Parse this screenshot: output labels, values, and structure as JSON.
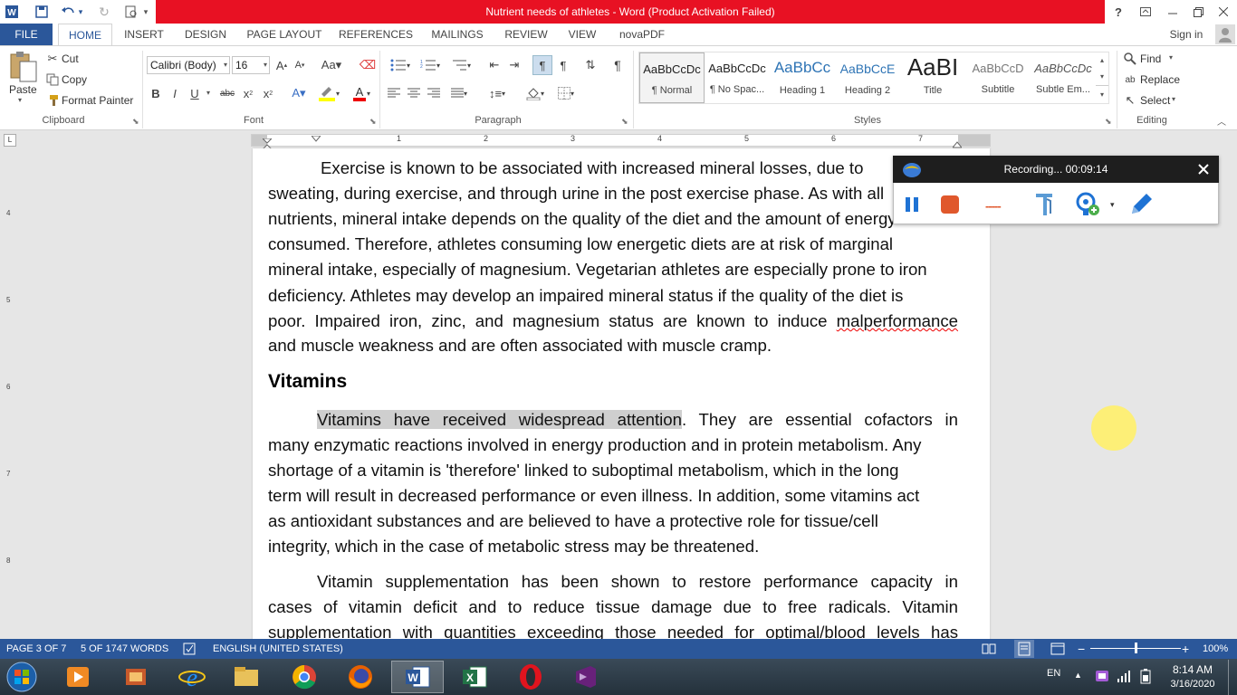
{
  "window": {
    "title": "Nutrient needs of athletes -  Word (Product Activation Failed)"
  },
  "qat": {
    "word_icon": "word-logo-icon",
    "save_icon": "save-icon",
    "undo_icon": "undo-icon",
    "redo_icon": "redo-icon",
    "preview_icon": "print-preview-icon"
  },
  "window_controls": {
    "help": "?",
    "ribbon_display": "ribbon-display-icon",
    "minimize": "minimize-icon",
    "restore": "restore-icon",
    "close": "close-icon"
  },
  "tabs": [
    "FILE",
    "HOME",
    "INSERT",
    "DESIGN",
    "PAGE LAYOUT",
    "REFERENCES",
    "MAILINGS",
    "REVIEW",
    "VIEW",
    "novaPDF"
  ],
  "sign_in": "Sign in",
  "clipboard": {
    "paste": "Paste",
    "cut": "Cut",
    "copy": "Copy",
    "format_painter": "Format Painter",
    "label": "Clipboard"
  },
  "font": {
    "name": "Calibri (Body)",
    "size": "16",
    "label": "Font"
  },
  "paragraph": {
    "label": "Paragraph"
  },
  "styles": {
    "label": "Styles",
    "items": [
      {
        "sample": "AaBbCcDc",
        "name": "¶ Normal"
      },
      {
        "sample": "AaBbCcDc",
        "name": "¶ No Spac..."
      },
      {
        "sample": "AaBbCc",
        "name": "Heading 1"
      },
      {
        "sample": "AaBbCcE",
        "name": "Heading 2"
      },
      {
        "sample": "AaBI",
        "name": "Title"
      },
      {
        "sample": "AaBbCcD",
        "name": "Subtitle"
      },
      {
        "sample": "AaBbCcDc",
        "name": "Subtle Em..."
      }
    ]
  },
  "editing": {
    "find": "Find",
    "replace": "Replace",
    "select": "Select",
    "label": "Editing"
  },
  "ruler": {
    "marks": [
      "1",
      "2",
      "3",
      "4",
      "5",
      "6",
      "7"
    ],
    "vmarks": [
      "4",
      "5",
      "6",
      "7",
      "8"
    ]
  },
  "document": {
    "para1_lines": [
      "Exercise is known to be associated with increased mineral losses, due to",
      "sweating, during exercise, and through urine in the post exercise phase. As with all",
      "nutrients, mineral intake depends on the quality of the diet and the amount of energy",
      "consumed. Therefore, athletes consuming low energetic diets are at risk of marginal",
      "mineral intake, especially of magnesium. Vegetarian athletes are especially prone to iron",
      "deficiency. Athletes may develop an impaired mineral status if the quality of the diet is",
      "poor. Impaired iron, zinc, and magnesium status are known to induce ",
      "and muscle weakness and are often associated with muscle cramp."
    ],
    "misspelled": "malperformance",
    "heading": "Vitamins",
    "highlight": "Vitamins have received widespread attention",
    "para2_first_rest": ". They are essential cofactors in",
    "para2_lines": [
      "many enzymatic reactions involved in energy production and in protein metabolism. Any",
      "shortage of a vitamin is 'therefore' linked to suboptimal metabolism, which in the long",
      "term will result in decreased performance or even illness. In addition, some vitamins act",
      "as antioxidant substances and are believed to have a protective role for tissue/cell",
      "integrity, which in the case of metabolic stress may be threatened."
    ],
    "para3_lines": [
      "Vitamin supplementation has been shown to restore performance capacity in",
      "cases of vitamin deficit and to reduce tissue damage due to free radicals. Vitamin",
      "supplementation with quantities exceeding those needed for optimal/blood levels has"
    ]
  },
  "recorder": {
    "title": "Recording... 00:09:14",
    "dashes": "-----"
  },
  "status": {
    "page": "PAGE 3 OF 7",
    "words": "5 OF 1747 WORDS",
    "language": "ENGLISH (UNITED STATES)",
    "zoom": "100%",
    "zoom_level": 1.0
  },
  "taskbar": {
    "lang": "EN",
    "time": "8:14 AM",
    "date": "3/16/2020"
  },
  "colors": {
    "word_blue": "#2b579a",
    "title_red": "#e81123",
    "highlight": "#cfcfcf"
  }
}
